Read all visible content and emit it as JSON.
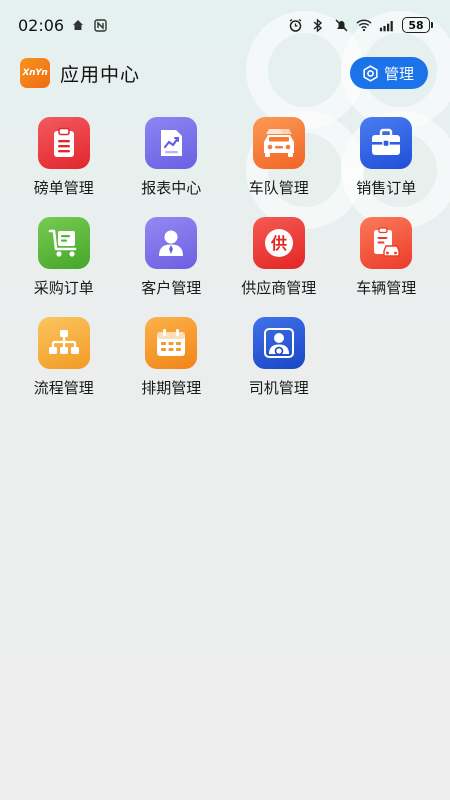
{
  "status_bar": {
    "time": "02:06",
    "battery": "58",
    "icons": [
      "home-icon",
      "nfc-icon",
      "alarm-icon",
      "bluetooth-icon",
      "mute-icon",
      "wifi-icon",
      "signal-icon"
    ]
  },
  "header": {
    "logo_text": "XnYn",
    "title": "应用中心",
    "manage_label": "管理",
    "manage_color": "#1a73e8"
  },
  "apps": [
    {
      "label": "磅单管理",
      "icon": "clipboard-icon",
      "color": "#e9343a"
    },
    {
      "label": "报表中心",
      "icon": "report-chart-icon",
      "color": "#6f6ce8"
    },
    {
      "label": "车队管理",
      "icon": "fleet-cars-icon",
      "color": "#f57b3a"
    },
    {
      "label": "销售订单",
      "icon": "briefcase-icon",
      "color": "#2c5fe6"
    },
    {
      "label": "采购订单",
      "icon": "cart-icon",
      "color": "#56b83a"
    },
    {
      "label": "客户管理",
      "icon": "customer-icon",
      "color": "#7a6ce8"
    },
    {
      "label": "供应商管理",
      "icon": "supplier-icon",
      "color": "#ee3a38"
    },
    {
      "label": "车辆管理",
      "icon": "vehicle-doc-icon",
      "color": "#f0513a"
    },
    {
      "label": "流程管理",
      "icon": "flow-icon",
      "color": "#f6a53a"
    },
    {
      "label": "排期管理",
      "icon": "calendar-icon",
      "color": "#f59a2a"
    },
    {
      "label": "司机管理",
      "icon": "driver-icon",
      "color": "#2358d6"
    }
  ]
}
